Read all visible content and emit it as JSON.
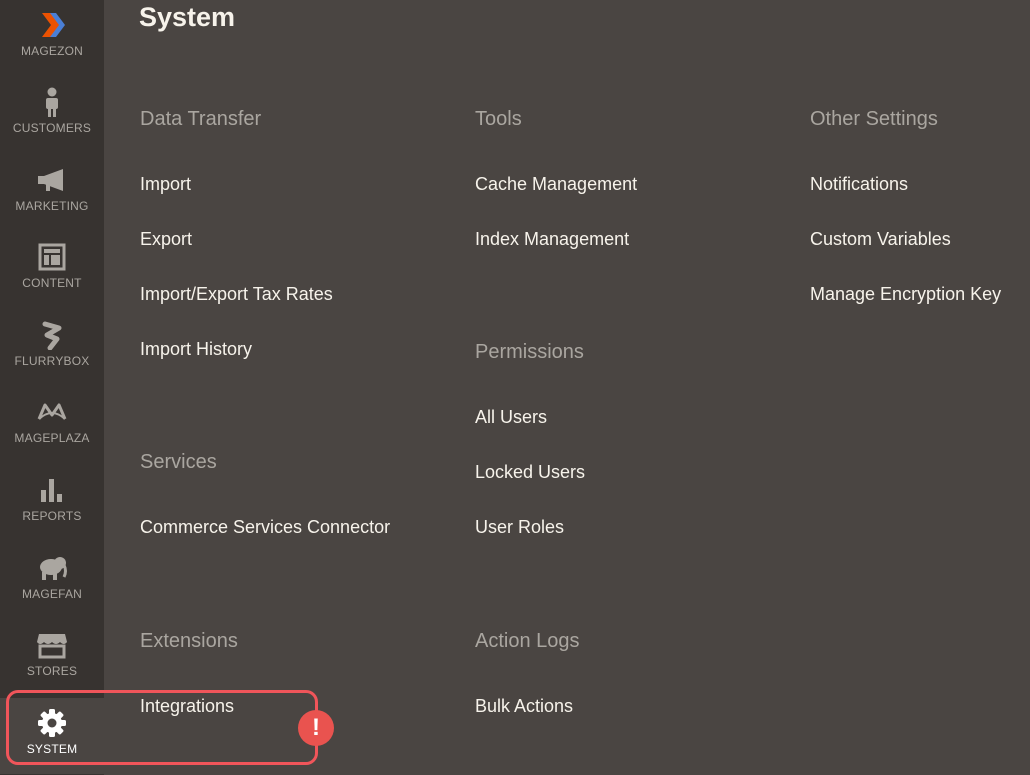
{
  "sidebar": {
    "items": [
      {
        "label": "MAGEZON",
        "icon": "magezon-logo-icon"
      },
      {
        "label": "CUSTOMERS",
        "icon": "person-icon"
      },
      {
        "label": "MARKETING",
        "icon": "megaphone-icon"
      },
      {
        "label": "CONTENT",
        "icon": "layout-icon"
      },
      {
        "label": "FLURRYBOX",
        "icon": "flurrybox-icon"
      },
      {
        "label": "MAGEPLAZA",
        "icon": "mageplaza-icon"
      },
      {
        "label": "REPORTS",
        "icon": "bar-chart-icon"
      },
      {
        "label": "MAGEFAN",
        "icon": "elephant-icon"
      },
      {
        "label": "STORES",
        "icon": "store-icon"
      },
      {
        "label": "SYSTEM",
        "icon": "gear-icon"
      }
    ]
  },
  "page": {
    "title": "System"
  },
  "groups": {
    "data_transfer": {
      "title": "Data Transfer",
      "links": [
        "Import",
        "Export",
        "Import/Export Tax Rates",
        "Import History"
      ]
    },
    "services": {
      "title": "Services",
      "links": [
        "Commerce Services Connector"
      ]
    },
    "extensions": {
      "title": "Extensions",
      "links": [
        "Integrations"
      ]
    },
    "tools": {
      "title": "Tools",
      "links": [
        "Cache Management",
        "Index Management"
      ]
    },
    "permissions": {
      "title": "Permissions",
      "links": [
        "All Users",
        "Locked Users",
        "User Roles"
      ]
    },
    "action_logs": {
      "title": "Action Logs",
      "links": [
        "Bulk Actions"
      ]
    },
    "other_settings": {
      "title": "Other Settings",
      "links": [
        "Notifications",
        "Custom Variables",
        "Manage Encryption Key"
      ]
    }
  },
  "alert": {
    "symbol": "!",
    "color": "#e9534f"
  },
  "colors": {
    "sidebar_bg": "#373330",
    "panel_bg": "#4a4542",
    "accent": "#eb5202",
    "highlight": "#f0555a"
  }
}
